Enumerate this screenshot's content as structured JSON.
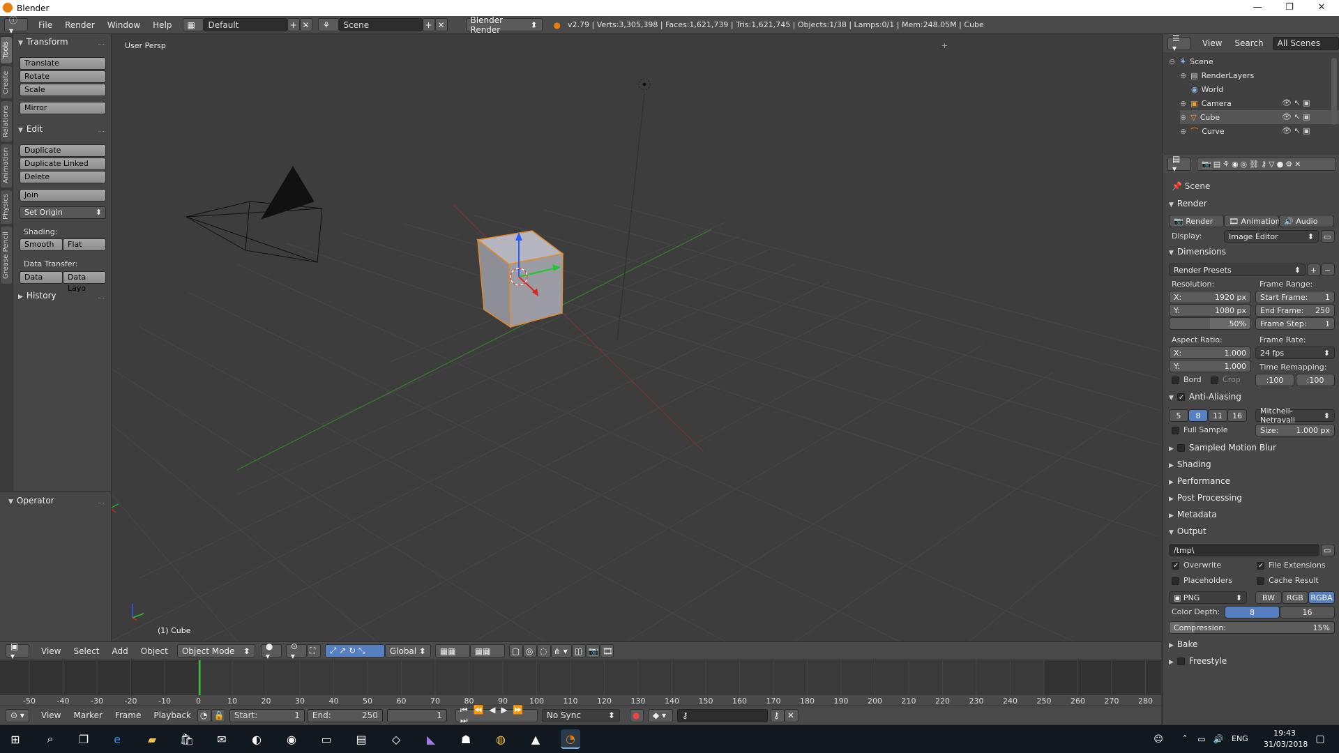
{
  "window": {
    "title": "Blender"
  },
  "info": {
    "menus": [
      "File",
      "Render",
      "Window",
      "Help"
    ],
    "layout": "Default",
    "scene": "Scene",
    "engine": "Blender Render",
    "stats": "v2.79 | Verts:3,305,398 | Faces:1,621,739 | Tris:1,621,745 | Objects:1/38 | Lamps:0/1 | Mem:248.05M | Cube"
  },
  "tool_tabs": [
    "Tools",
    "Create",
    "Relations",
    "Animation",
    "Physics",
    "Grease Pencil"
  ],
  "toolshelf": {
    "transform_title": "Transform",
    "translate": "Translate",
    "rotate": "Rotate",
    "scale": "Scale",
    "mirror": "Mirror",
    "edit_title": "Edit",
    "duplicate": "Duplicate",
    "duplicate_linked": "Duplicate Linked",
    "delete": "Delete",
    "join": "Join",
    "set_origin": "Set Origin",
    "shading_label": "Shading:",
    "smooth": "Smooth",
    "flat": "Flat",
    "data_transfer_label": "Data Transfer:",
    "data": "Data",
    "data_layo": "Data Layo",
    "history_title": "History",
    "operator_title": "Operator"
  },
  "viewport": {
    "view_name": "User Persp",
    "object_label": "(1) Cube"
  },
  "view3d_header": {
    "menus": [
      "View",
      "Select",
      "Add",
      "Object"
    ],
    "mode": "Object Mode",
    "orientation": "Global"
  },
  "timeline": {
    "ticks": [
      "-50",
      "-40",
      "-30",
      "-20",
      "-10",
      "0",
      "10",
      "20",
      "30",
      "40",
      "50",
      "60",
      "70",
      "80",
      "90",
      "100",
      "110",
      "120",
      "130",
      "140",
      "150",
      "160",
      "170",
      "180",
      "190",
      "200",
      "210",
      "220",
      "230",
      "240",
      "250",
      "260",
      "270",
      "280"
    ],
    "current_frame": 0
  },
  "timeline_header": {
    "menus": [
      "View",
      "Marker",
      "Frame",
      "Playback"
    ],
    "start_label": "Start:",
    "start": "1",
    "end_label": "End:",
    "end": "250",
    "current": "1",
    "sync": "No Sync"
  },
  "outliner": {
    "menus": [
      "View",
      "Search"
    ],
    "filter": "All Scenes",
    "items": [
      "Scene",
      "RenderLayers",
      "World",
      "Camera",
      "Cube",
      "Curve"
    ]
  },
  "properties": {
    "context": "Scene",
    "render_title": "Render",
    "render_btn": "Render",
    "animation_btn": "Animation",
    "audio_btn": "Audio",
    "display_label": "Display:",
    "display_value": "Image Editor",
    "dimensions_title": "Dimensions",
    "render_presets": "Render Presets",
    "resolution_label": "Resolution:",
    "res_x_label": "X:",
    "res_x": "1920 px",
    "res_y_label": "Y:",
    "res_y": "1080 px",
    "res_pct": "50%",
    "frame_range_label": "Frame Range:",
    "start_frame_label": "Start Frame:",
    "start_frame": "1",
    "end_frame_label": "End Frame:",
    "end_frame": "250",
    "frame_step_label": "Frame Step:",
    "frame_step": "1",
    "aspect_label": "Aspect Ratio:",
    "aspect_x_label": "X:",
    "aspect_x": "1.000",
    "aspect_y_label": "Y:",
    "aspect_y": "1.000",
    "frame_rate_label": "Frame Rate:",
    "frame_rate": "24 fps",
    "time_remap_label": "Time Remapping:",
    "remap_old": ":100",
    "remap_new": ":100",
    "bord": "Bord",
    "crop": "Crop",
    "aa_title": "Anti-Aliasing",
    "aa_samples": [
      "5",
      "8",
      "11",
      "16"
    ],
    "aa_filter": "Mitchell-Netravali",
    "full_sample": "Full Sample",
    "size_label": "Size:",
    "size_value": "1.000 px",
    "motion_blur": "Sampled Motion Blur",
    "shading": "Shading",
    "performance": "Performance",
    "post_processing": "Post Processing",
    "metadata": "Metadata",
    "output_title": "Output",
    "output_path": "/tmp\\",
    "overwrite": "Overwrite",
    "file_extensions": "File Extensions",
    "placeholders": "Placeholders",
    "cache_result": "Cache Result",
    "format": "PNG",
    "bw": "BW",
    "rgb": "RGB",
    "rgba": "RGBA",
    "color_depth_label": "Color Depth:",
    "depth_8": "8",
    "depth_16": "16",
    "compression_label": "Compression:",
    "compression": "15%",
    "bake": "Bake",
    "freestyle": "Freestyle"
  },
  "taskbar": {
    "lang": "ENG",
    "time": "19:43",
    "date": "31/03/2018"
  }
}
